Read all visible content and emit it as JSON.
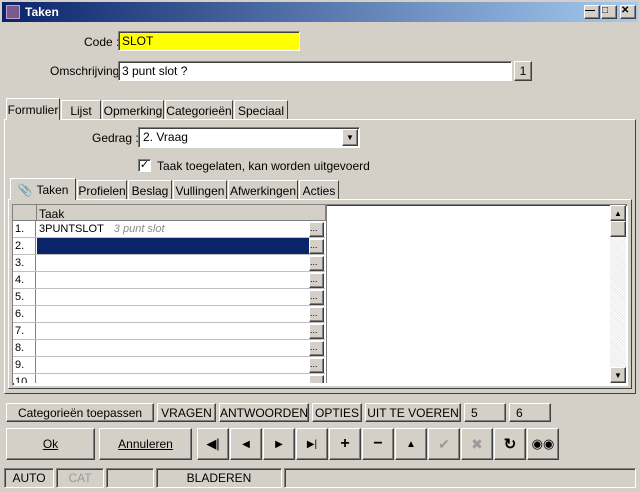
{
  "window": {
    "title": "Taken"
  },
  "form": {
    "code_label": "Code :",
    "code_value": "SLOT",
    "omschrijving_label": "Omschrijving :",
    "omschrijving_value": "3 punt slot ?",
    "lang_badge": "1",
    "gedrag_label": "Gedrag :",
    "gedrag_value": "2.  Vraag",
    "checkbox_label": "Taak toegelaten, kan worden uitgevoerd",
    "checkbox_checked": true
  },
  "main_tabs": [
    "Formulier",
    "Lijst",
    "Opmerking",
    "Categorieën",
    "Speciaal"
  ],
  "sub_tabs": [
    "Taken",
    "Profielen",
    "Beslag",
    "Vullingen",
    "Afwerkingen",
    "Acties"
  ],
  "grid": {
    "header": "Taak",
    "rows": [
      {
        "num": "1.",
        "code": "3PUNTSLOT",
        "desc": "3 punt slot"
      },
      {
        "num": "2.",
        "code": "",
        "desc": ""
      },
      {
        "num": "3.",
        "code": "",
        "desc": ""
      },
      {
        "num": "4.",
        "code": "",
        "desc": ""
      },
      {
        "num": "5.",
        "code": "",
        "desc": ""
      },
      {
        "num": "6.",
        "code": "",
        "desc": ""
      },
      {
        "num": "7.",
        "code": "",
        "desc": ""
      },
      {
        "num": "8.",
        "code": "",
        "desc": ""
      },
      {
        "num": "9.",
        "code": "",
        "desc": ""
      },
      {
        "num": "10.",
        "code": "",
        "desc": ""
      }
    ],
    "dots_label": "..."
  },
  "action_row": {
    "categorieen": "Categorieën toepassen",
    "vragen": "VRAGEN",
    "antwoorden": "ANTWOORDEN",
    "opties": "OPTIES",
    "uit_te_voeren": "UIT TE VOEREN",
    "five": "5",
    "six": "6"
  },
  "buttons": {
    "ok": "Ok",
    "annuleren": "Annuleren"
  },
  "status_bar": {
    "auto": "AUTO",
    "cat": "CAT",
    "empty1": "",
    "mode": "BLADEREN"
  }
}
